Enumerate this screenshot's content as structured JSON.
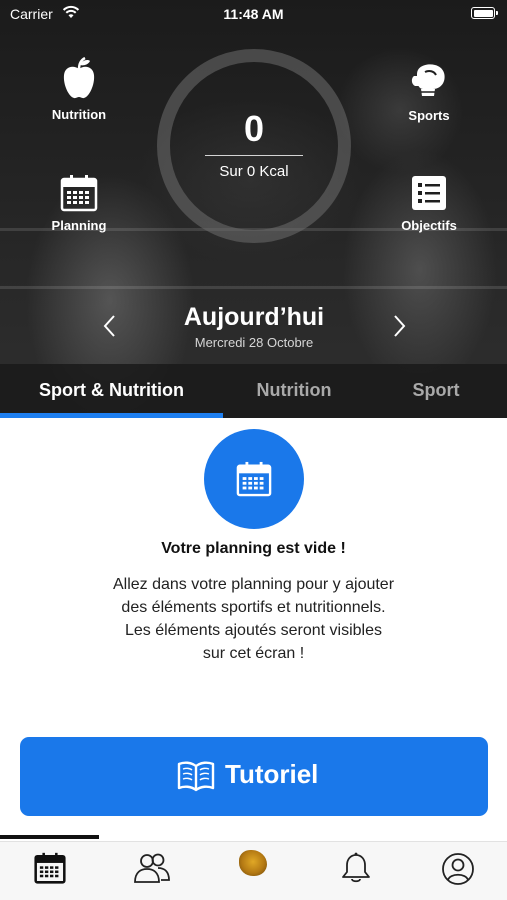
{
  "status_bar": {
    "carrier": "Carrier",
    "time": "11:48 AM"
  },
  "header": {
    "shortcuts": {
      "nutrition": {
        "label": "Nutrition",
        "icon": "apple-icon"
      },
      "sports": {
        "label": "Sports",
        "icon": "boxing-glove-icon"
      },
      "planning": {
        "label": "Planning",
        "icon": "calendar-icon"
      },
      "objectifs": {
        "label": "Objectifs",
        "icon": "checklist-icon"
      }
    },
    "calories": {
      "value": "0",
      "subtitle": "Sur 0 Kcal",
      "progress": 0
    },
    "date": {
      "title": "Aujourd’hui",
      "subtitle": "Mercredi 28 Octobre"
    }
  },
  "tabs": [
    {
      "label": "Sport & Nutrition",
      "active": true
    },
    {
      "label": "Nutrition",
      "active": false
    },
    {
      "label": "Sport",
      "active": false
    }
  ],
  "empty_state": {
    "icon": "calendar-icon",
    "title": "Votre planning est vide !",
    "lines": [
      "Allez dans votre planning pour y ajouter",
      "des éléments sportifs et nutritionnels.",
      "Les éléments ajoutés seront visibles",
      "sur cet écran !"
    ]
  },
  "tutorial_button": {
    "label": "Tutoriel",
    "icon": "book-icon"
  },
  "tab_bar": {
    "items": [
      {
        "icon": "calendar-icon",
        "active": true
      },
      {
        "icon": "users-icon",
        "active": false
      },
      {
        "icon": "brand-logo",
        "active": false
      },
      {
        "icon": "bell-icon",
        "active": false
      },
      {
        "icon": "profile-icon",
        "active": false
      }
    ]
  },
  "colors": {
    "accent": "#1a78ea",
    "dark": "#1b1b1b"
  }
}
